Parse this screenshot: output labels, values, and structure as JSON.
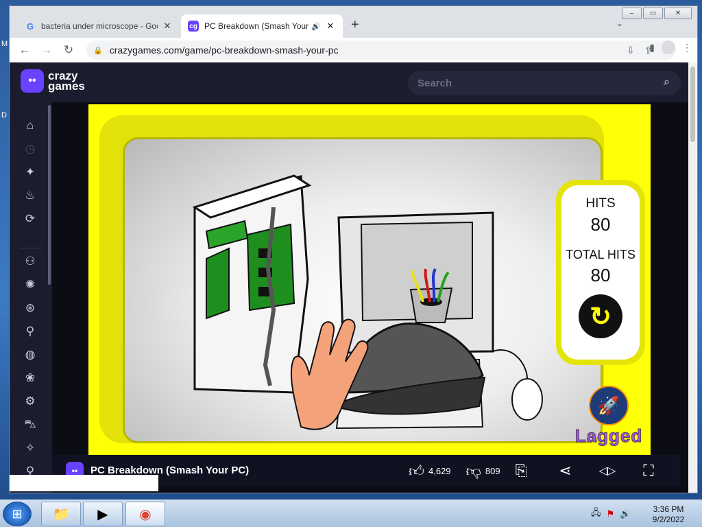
{
  "desktop": {
    "letters": [
      "M",
      "D"
    ]
  },
  "browser": {
    "tabs": [
      {
        "favicon": "google-favicon",
        "title": "bacteria under microscope - Goo",
        "close": "✕"
      },
      {
        "favicon": "crazygames-favicon",
        "title": "PC Breakdown (Smash Your I",
        "close": "✕",
        "audio": "🔊"
      }
    ],
    "new_tab": "+",
    "tab_menu": "⌄",
    "url": "crazygames.com/game/pc-breakdown-smash-your-pc",
    "window_controls": {
      "minimize": "–",
      "restore": "▭",
      "close": "✕"
    }
  },
  "site": {
    "logo": {
      "line1": "crazy",
      "line2": "games"
    },
    "search": {
      "placeholder": "Search"
    },
    "sidebar_icons": [
      "home-icon",
      "clock-icon",
      "sparkle-icon",
      "flame-icon",
      "refresh-icon",
      "users-icon",
      "splash-icon",
      "compass-icon",
      "joystick-icon",
      "basketball-icon",
      "flower-icon",
      "bike-icon",
      "car-icon",
      "wand-icon",
      "controller-icon"
    ],
    "game": {
      "hits_label": "HITS",
      "hits_value": "80",
      "total_label": "TOTAL HITS",
      "total_value": "80",
      "brand": "Lagged"
    },
    "game_bar": {
      "title": "PC Breakdown (Smash Your PC)",
      "likes": "4,629",
      "dislikes": "809"
    }
  },
  "taskbar": {
    "time": "3:36 PM",
    "date": "9/2/2022"
  }
}
